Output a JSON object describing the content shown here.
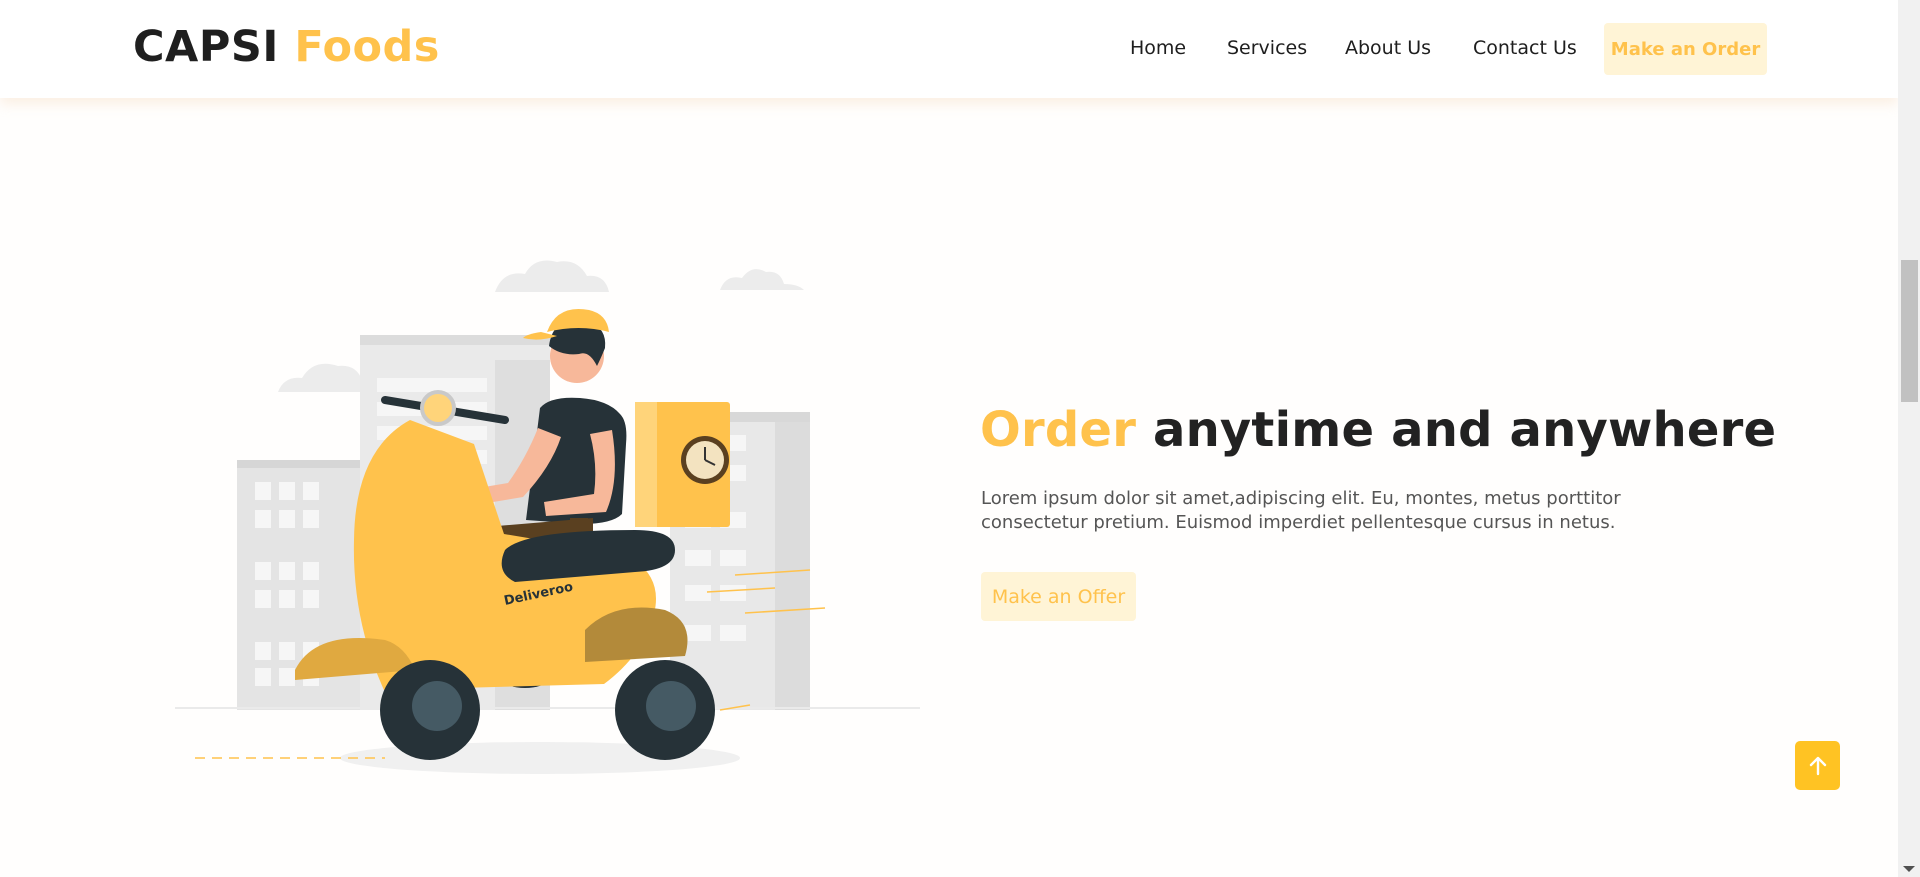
{
  "header": {
    "logo_primary": "CAPSI",
    "logo_accent": "Foods",
    "nav": {
      "home": "Home",
      "services": "Services",
      "about": "About Us",
      "contact": "Contact Us"
    },
    "cta": "Make an Order"
  },
  "hero": {
    "headline_accent": "Order",
    "headline_rest": " anytime and anywhere",
    "description": "Lorem ipsum dolor sit amet,adipiscing elit. Eu, montes, metus porttitor consectetur pretium. Euismod imperdiet pellentesque cursus in netus.",
    "button": "Make an Offer",
    "illustration_label": "Deliveroo"
  },
  "icons": {
    "back_to_top": "arrow-up-icon"
  },
  "colors": {
    "accent": "#ffc24c",
    "accent_light": "#fff4d6",
    "text_dark": "#222222",
    "back_to_top": "#ffc323"
  }
}
